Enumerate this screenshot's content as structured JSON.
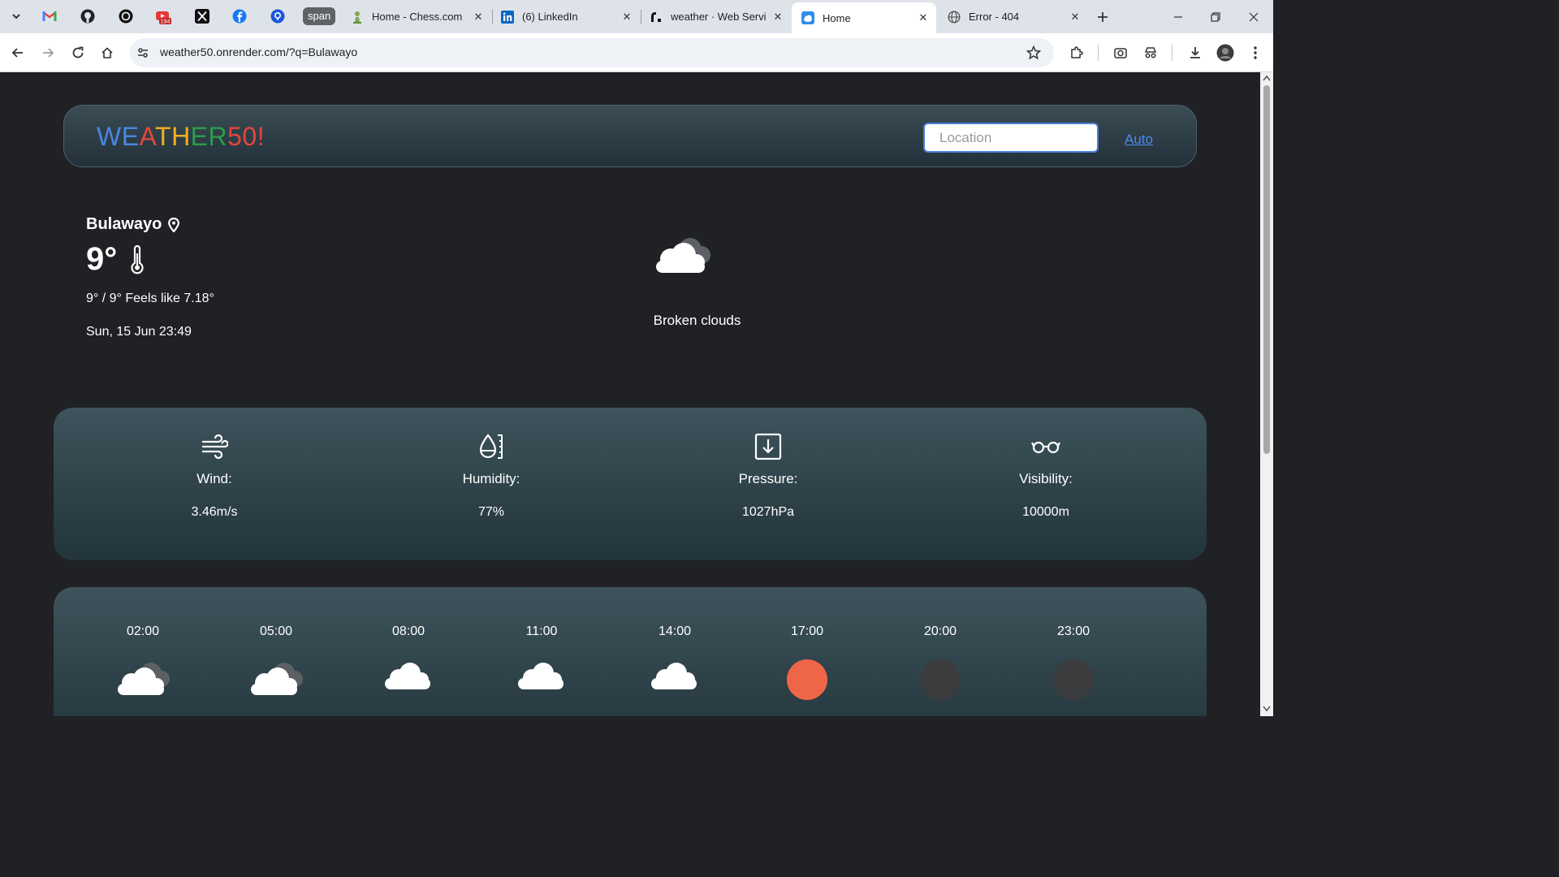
{
  "browser": {
    "tabs": [
      {
        "title": "Home - Chess.com"
      },
      {
        "title": "(6) LinkedIn"
      },
      {
        "title": "weather · Web Servi"
      },
      {
        "title": "Home"
      },
      {
        "title": "Error - 404"
      }
    ],
    "active_tab_index": 3,
    "pinned_badge_count": "194",
    "pinned_group_label": "span",
    "url": "weather50.onrender.com/?q=Bulawayo"
  },
  "header": {
    "logo_letters": [
      {
        "ch": "W",
        "color": "#4a86e0"
      },
      {
        "ch": "E",
        "color": "#4a86e0"
      },
      {
        "ch": "A",
        "color": "#e4463a"
      },
      {
        "ch": "T",
        "color": "#f2b01e"
      },
      {
        "ch": "H",
        "color": "#f2b01e"
      },
      {
        "ch": "E",
        "color": "#2f9a4a"
      },
      {
        "ch": "R",
        "color": "#2f9a4a"
      },
      {
        "ch": "5",
        "color": "#e4463a"
      },
      {
        "ch": "0",
        "color": "#e4463a"
      },
      {
        "ch": "!",
        "color": "#e4463a"
      }
    ],
    "search_placeholder": "Location",
    "auto_label": "Auto"
  },
  "current": {
    "city": "Bulawayo",
    "temperature": "9°",
    "range_feels": "9° / 9° Feels like 7.18°",
    "datetime": "Sun, 15 Jun 23:49",
    "description": "Broken clouds",
    "icon": "broken-clouds-icon"
  },
  "stats": [
    {
      "label": "Wind:",
      "value": "3.46m/s",
      "icon": "wind-icon"
    },
    {
      "label": "Humidity:",
      "value": "77%",
      "icon": "humidity-icon"
    },
    {
      "label": "Pressure:",
      "value": "1027hPa",
      "icon": "pressure-icon"
    },
    {
      "label": "Visibility:",
      "value": "10000m",
      "icon": "visibility-icon"
    }
  ],
  "hourly": [
    {
      "time": "02:00",
      "icon": "broken-clouds-icon"
    },
    {
      "time": "05:00",
      "icon": "broken-clouds-icon"
    },
    {
      "time": "08:00",
      "icon": "cloud-icon"
    },
    {
      "time": "11:00",
      "icon": "cloud-icon"
    },
    {
      "time": "14:00",
      "icon": "cloud-icon"
    },
    {
      "time": "17:00",
      "icon": "sun-icon"
    },
    {
      "time": "20:00",
      "icon": "moon-icon"
    },
    {
      "time": "23:00",
      "icon": "moon-icon"
    }
  ],
  "colors": {
    "page_bg": "#202124",
    "sun": "#ef6548",
    "moon": "#3a3c3e",
    "link": "#4a8cf0"
  }
}
